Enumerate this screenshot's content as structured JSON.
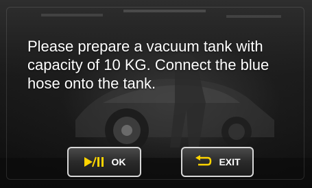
{
  "dialog": {
    "message": "Please prepare a vacuum tank with capacity of 10 KG. Connect the blue hose onto the tank."
  },
  "buttons": {
    "ok_label": "OK",
    "exit_label": "EXIT",
    "ok_icon": "play-pause-icon",
    "exit_icon": "return-arrow-icon"
  },
  "colors": {
    "icon_accent": "#ffd400",
    "text": "#ffffff",
    "button_border": "#d8d8d8"
  }
}
